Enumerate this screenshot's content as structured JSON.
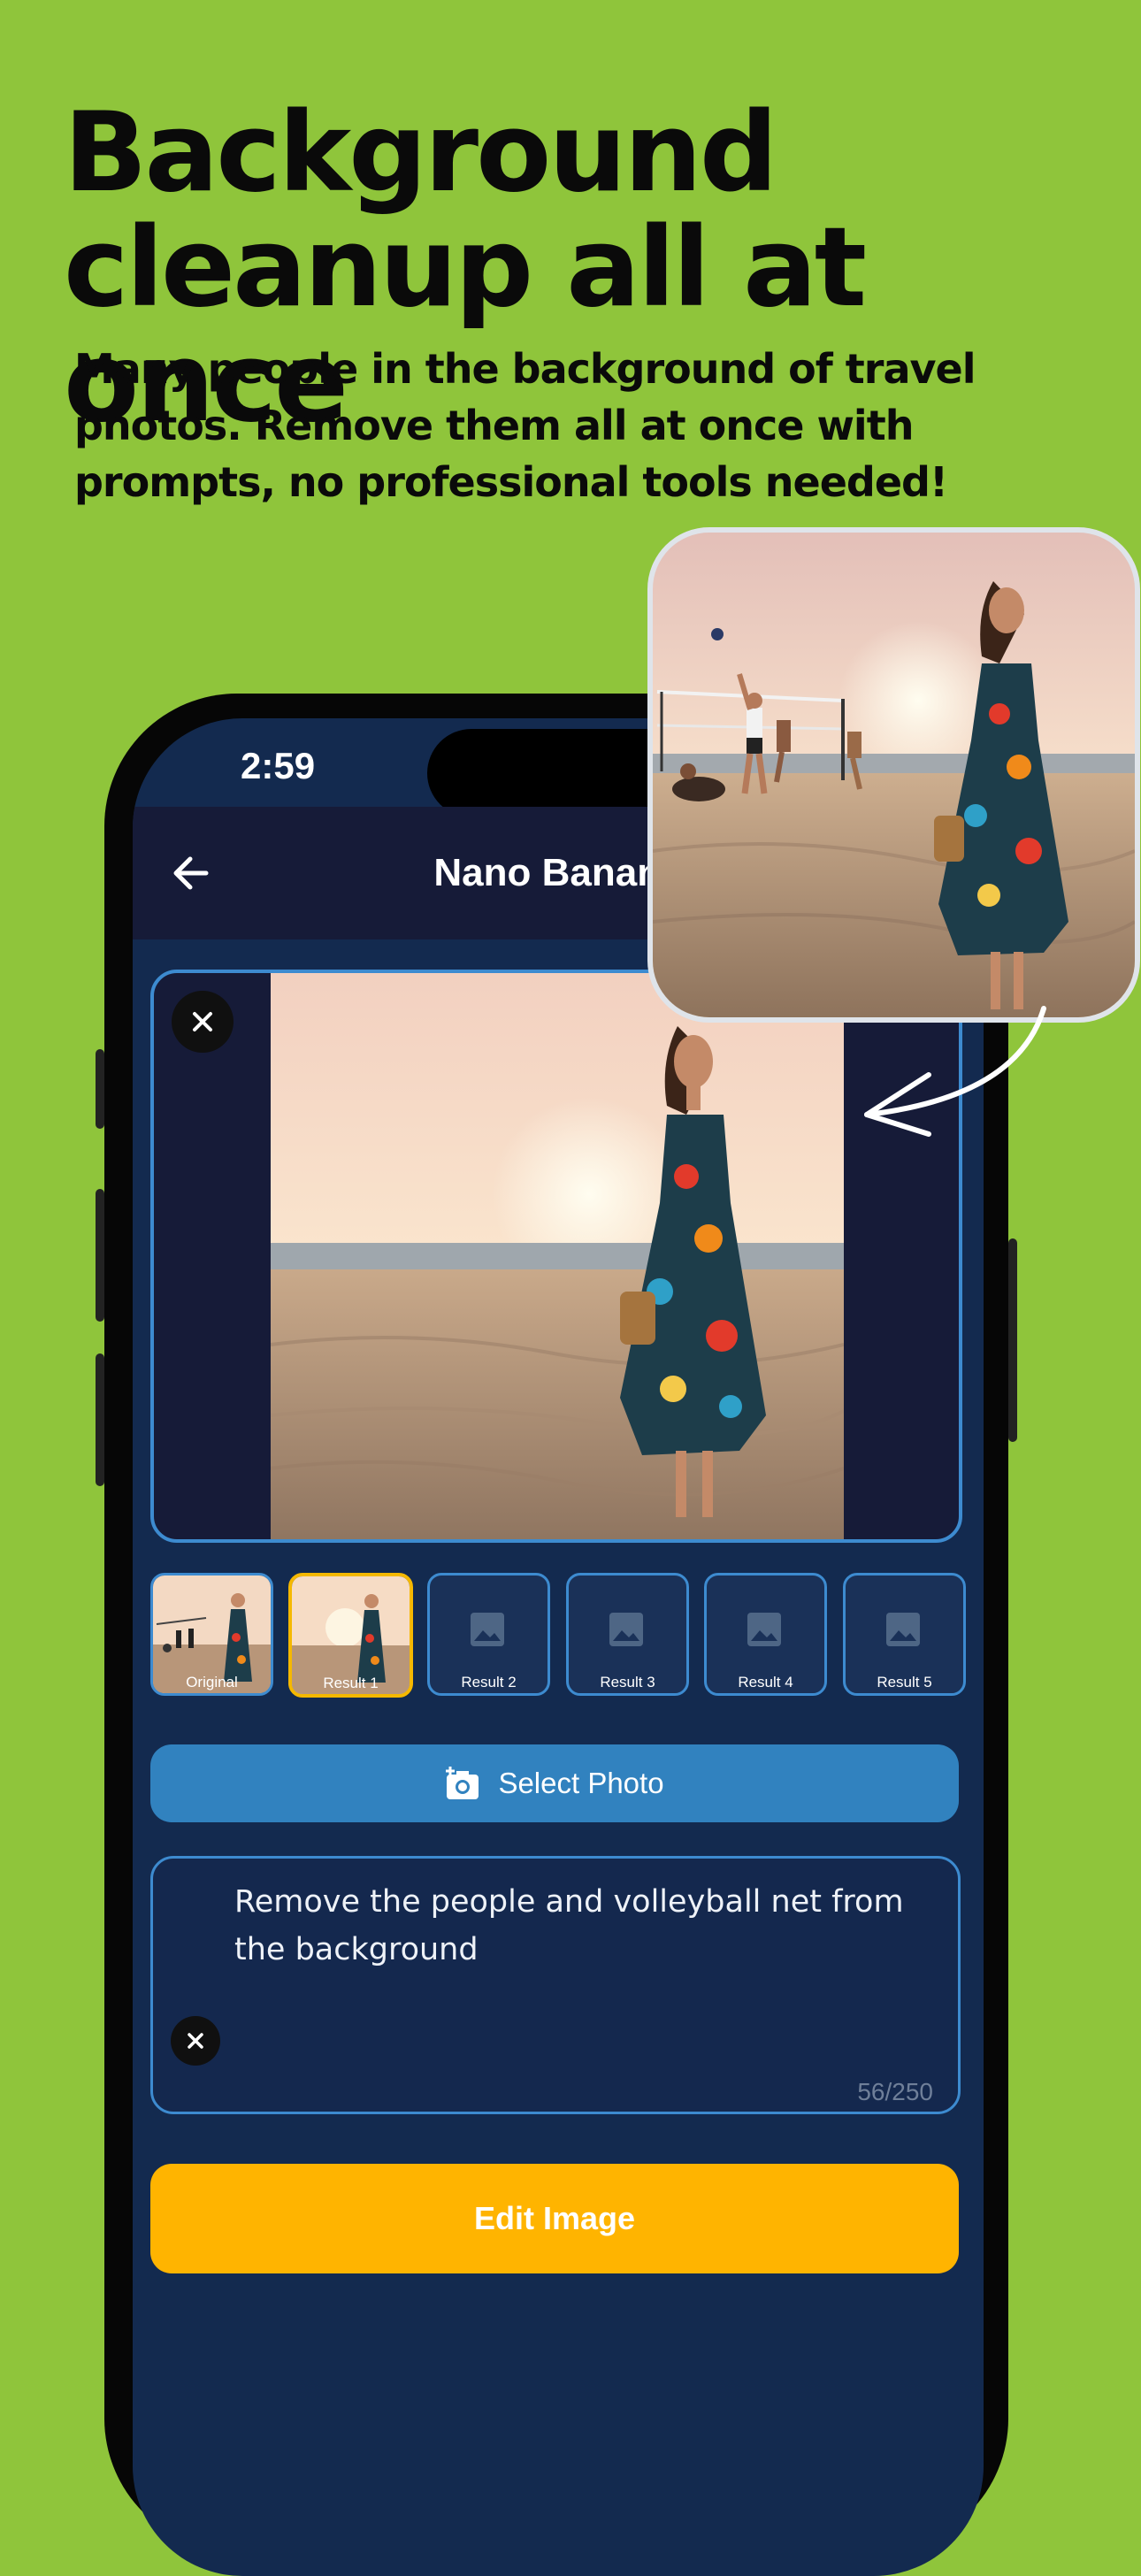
{
  "banner": {
    "headline_line1": "Background",
    "headline_line2": "cleanup all at once",
    "subline_line1": "Many people in the background of travel",
    "subline_line2": "photos. Remove them all at once with",
    "subline_line3": "prompts, no professional tools needed!"
  },
  "status_bar": {
    "time": "2:59"
  },
  "app_bar": {
    "title": "Nano Banana",
    "back_icon": "arrow-left-icon"
  },
  "preview": {
    "close_icon": "close-icon",
    "image": "woman-on-beach-at-sunset-edited"
  },
  "popout_image": "woman-on-beach-with-volleyball-players-original",
  "thumbnails": [
    {
      "label": "Original",
      "selected": false,
      "has_image": true
    },
    {
      "label": "Result 1",
      "selected": true,
      "has_image": true
    },
    {
      "label": "Result 2",
      "selected": false,
      "has_image": false
    },
    {
      "label": "Result 3",
      "selected": false,
      "has_image": false
    },
    {
      "label": "Result 4",
      "selected": false,
      "has_image": false
    },
    {
      "label": "Result 5",
      "selected": false,
      "has_image": false
    }
  ],
  "select_photo": {
    "label": "Select Photo",
    "icon": "add-photo-camera-icon"
  },
  "prompt": {
    "value": "Remove the people and volleyball net from the background",
    "char_count": "56/250",
    "clear_icon": "close-icon"
  },
  "edit_button": {
    "label": "Edit Image"
  },
  "colors": {
    "background": "#8fc53b",
    "app_bg": "#132a4f",
    "accent_blue": "#3182bf",
    "accent_yellow": "#ffb400",
    "border_blue": "#3d8bd0"
  }
}
